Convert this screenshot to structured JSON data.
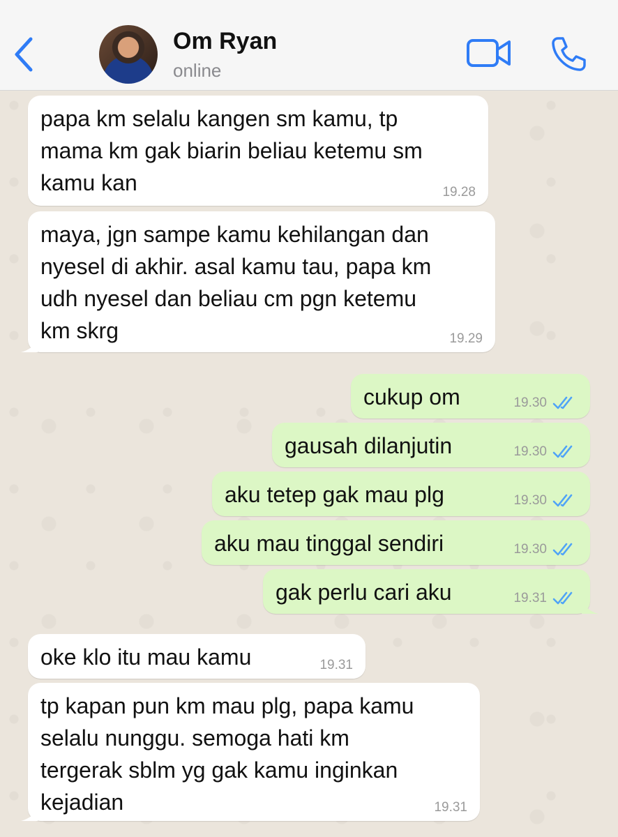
{
  "header": {
    "back_icon": "chevron-left-icon",
    "contact_name": "Om Ryan",
    "contact_status": "online",
    "video_icon": "video-camera-icon",
    "call_icon": "phone-icon",
    "accent_color": "#2f7cf6"
  },
  "messages": [
    {
      "direction": "in",
      "text": "papa km selalu kangen sm kamu, tp\nmama km gak biarin beliau ketemu sm\nkamu kan",
      "time": "19.28"
    },
    {
      "direction": "in",
      "text": "maya, jgn sampe kamu kehilangan dan\nnyesel di akhir. asal kamu tau, papa km\nudh nyesel dan beliau cm pgn ketemu\nkm skrg",
      "time": "19.29"
    },
    {
      "direction": "out",
      "text": "cukup om",
      "time": "19.30",
      "status": "read"
    },
    {
      "direction": "out",
      "text": "gausah dilanjutin",
      "time": "19.30",
      "status": "read"
    },
    {
      "direction": "out",
      "text": "aku tetep gak mau plg",
      "time": "19.30",
      "status": "read"
    },
    {
      "direction": "out",
      "text": "aku mau tinggal sendiri",
      "time": "19.30",
      "status": "read"
    },
    {
      "direction": "out",
      "text": "gak perlu cari aku",
      "time": "19.31",
      "status": "read"
    },
    {
      "direction": "in",
      "text": "oke klo itu mau kamu",
      "time": "19.31"
    },
    {
      "direction": "in",
      "text": "tp kapan pun km mau plg, papa kamu\nselalu nunggu. semoga hati km\ntergerak sblm yg gak kamu inginkan\nkejadian",
      "time": "19.31"
    }
  ],
  "colors": {
    "incoming_bubble": "#ffffff",
    "outgoing_bubble": "#dcf7c5",
    "read_ticks": "#4fa3f7",
    "chat_background": "#ebe5dc"
  }
}
